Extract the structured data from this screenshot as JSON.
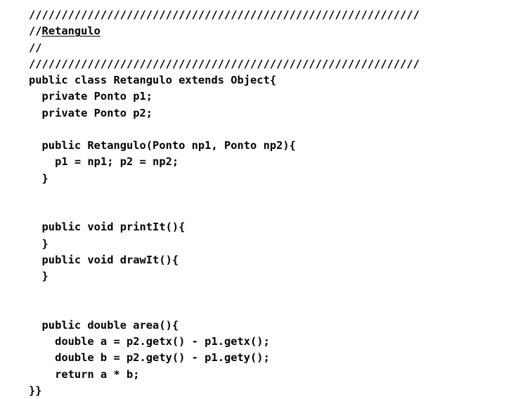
{
  "slide": {
    "type": "code-slide",
    "background_color": "#ffffff",
    "text_color": "#000000",
    "font_style": "bold monospace"
  },
  "code": {
    "language": "Java",
    "class_name": "Retangulo",
    "lines": [
      {
        "id": "l1",
        "text": "////////////////////////////////////////////////////////////",
        "link": null
      },
      {
        "id": "l2",
        "text": "//Retangulo",
        "link": "Retangulo",
        "link_prefix": "//"
      },
      {
        "id": "l3",
        "text": "//",
        "link": null
      },
      {
        "id": "l4",
        "text": "////////////////////////////////////////////////////////////",
        "link": null
      },
      {
        "id": "l5",
        "text": "public class Retangulo extends Object{",
        "link": null
      },
      {
        "id": "l6",
        "text": "  private Ponto p1;",
        "link": null
      },
      {
        "id": "l7",
        "text": "  private Ponto p2;",
        "link": null
      },
      {
        "id": "l8",
        "text": "",
        "link": null
      },
      {
        "id": "l9",
        "text": "  public Retangulo(Ponto np1, Ponto np2){",
        "link": null
      },
      {
        "id": "l10",
        "text": "    p1 = np1; p2 = np2;",
        "link": null
      },
      {
        "id": "l11",
        "text": "  }",
        "link": null
      },
      {
        "id": "l12",
        "text": "",
        "link": null
      },
      {
        "id": "l13",
        "text": "",
        "link": null
      },
      {
        "id": "l14",
        "text": "  public void printIt(){",
        "link": null
      },
      {
        "id": "l15",
        "text": "  }",
        "link": null
      },
      {
        "id": "l16",
        "text": "  public void drawIt(){",
        "link": null
      },
      {
        "id": "l17",
        "text": "  }",
        "link": null
      },
      {
        "id": "l18",
        "text": "",
        "link": null
      },
      {
        "id": "l19",
        "text": "",
        "link": null
      },
      {
        "id": "l20",
        "text": "  public double area(){",
        "link": null
      },
      {
        "id": "l21",
        "text": "    double a = p2.getx() - p1.getx();",
        "link": null
      },
      {
        "id": "l22",
        "text": "    double b = p2.gety() - p1.gety();",
        "link": null
      },
      {
        "id": "l23",
        "text": "    return a * b;",
        "link": null
      },
      {
        "id": "l24",
        "text": "}}",
        "link": null
      }
    ]
  }
}
